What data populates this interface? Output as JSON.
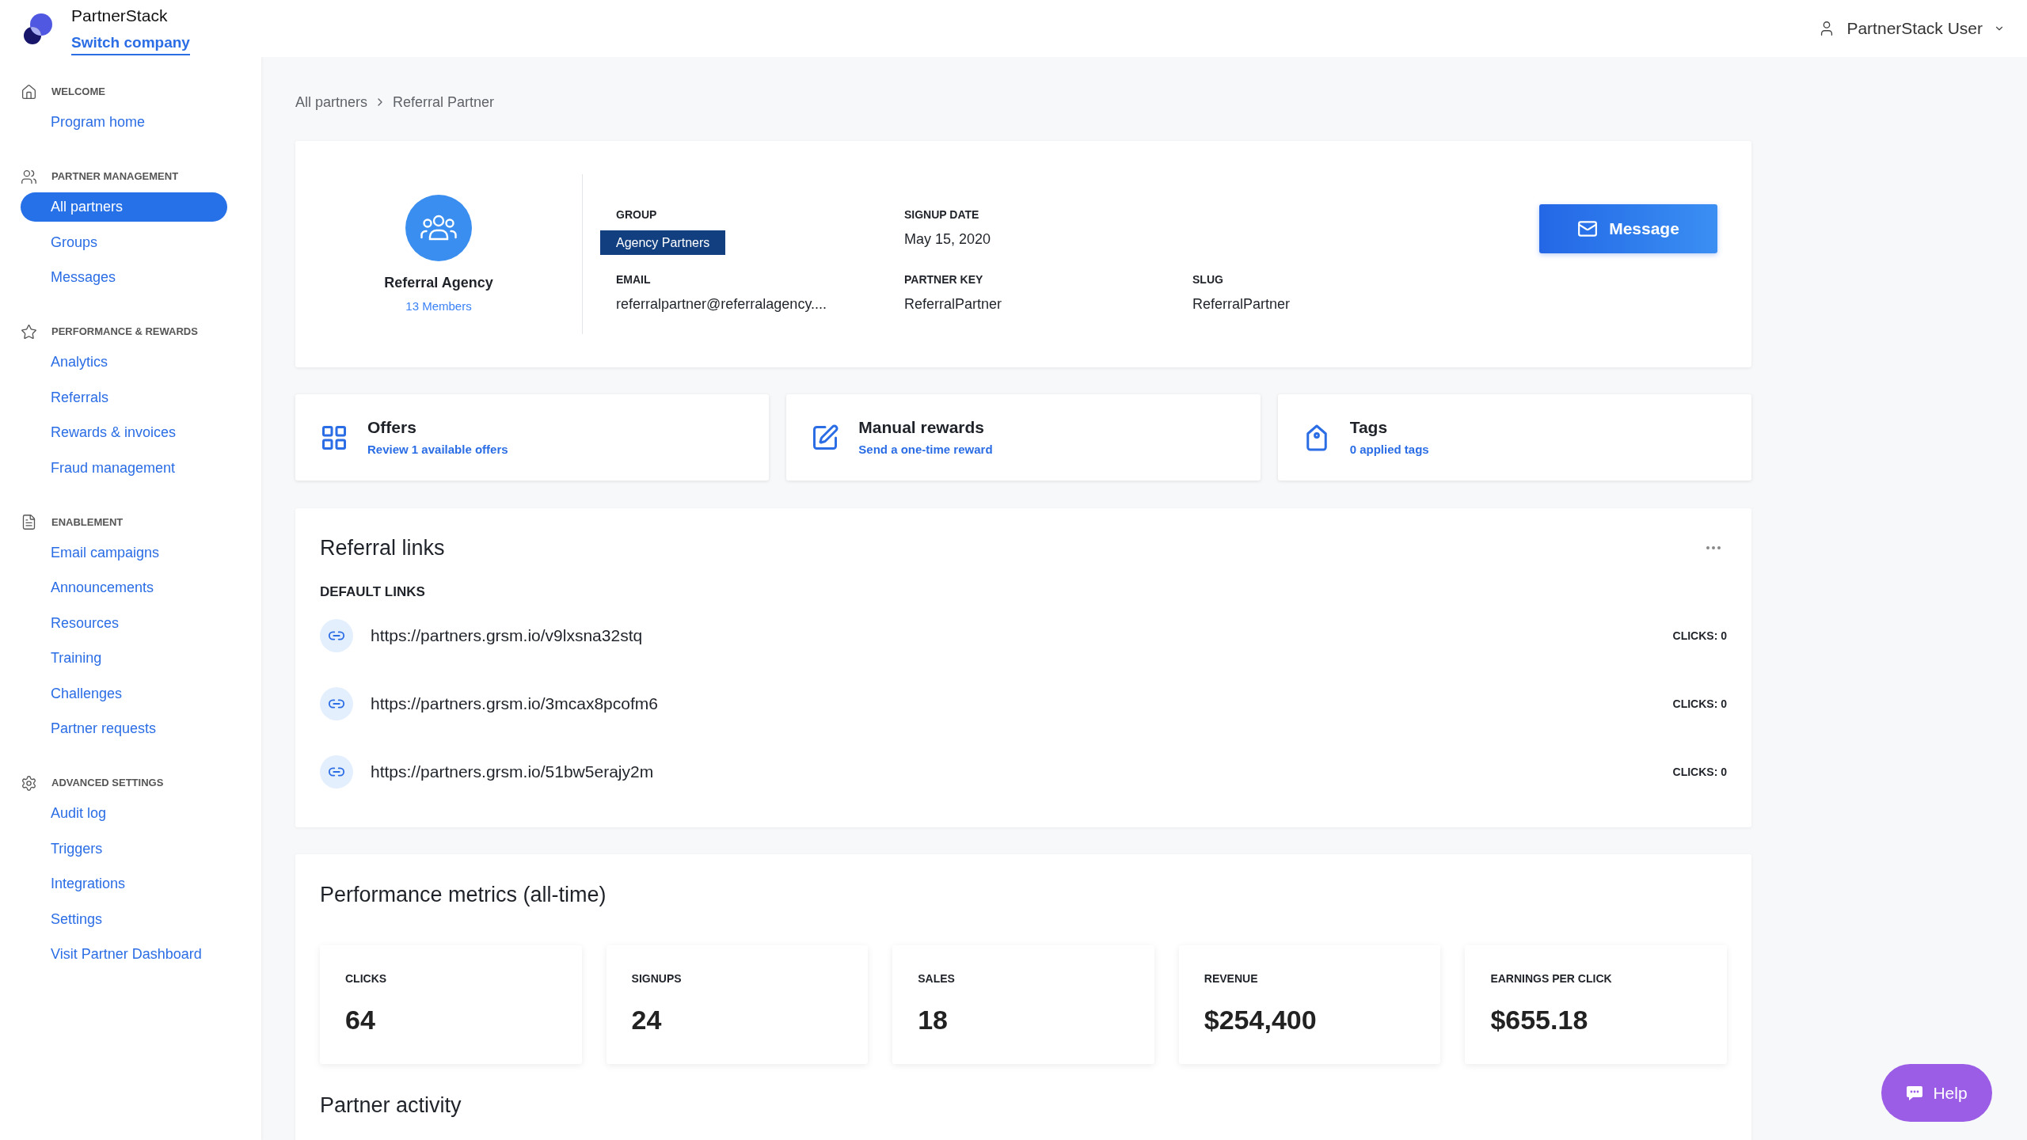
{
  "header": {
    "brand": "PartnerStack",
    "switch_company": "Switch company",
    "user": "PartnerStack User"
  },
  "sidebar": {
    "sections": [
      {
        "title": "WELCOME",
        "items": [
          {
            "label": "Program home",
            "selected": false
          }
        ]
      },
      {
        "title": "PARTNER MANAGEMENT",
        "items": [
          {
            "label": "All partners",
            "selected": true
          },
          {
            "label": "Groups",
            "selected": false
          },
          {
            "label": "Messages",
            "selected": false
          }
        ]
      },
      {
        "title": "PERFORMANCE & REWARDS",
        "items": [
          {
            "label": "Analytics",
            "selected": false
          },
          {
            "label": "Referrals",
            "selected": false
          },
          {
            "label": "Rewards & invoices",
            "selected": false
          },
          {
            "label": "Fraud management",
            "selected": false
          }
        ]
      },
      {
        "title": "ENABLEMENT",
        "items": [
          {
            "label": "Email campaigns",
            "selected": false
          },
          {
            "label": "Announcements",
            "selected": false
          },
          {
            "label": "Resources",
            "selected": false
          },
          {
            "label": "Training",
            "selected": false
          },
          {
            "label": "Challenges",
            "selected": false
          },
          {
            "label": "Partner requests",
            "selected": false
          }
        ]
      },
      {
        "title": "ADVANCED SETTINGS",
        "items": [
          {
            "label": "Audit log",
            "selected": false
          },
          {
            "label": "Triggers",
            "selected": false
          },
          {
            "label": "Integrations",
            "selected": false
          },
          {
            "label": "Settings",
            "selected": false
          },
          {
            "label": "Visit Partner Dashboard",
            "selected": false
          }
        ]
      }
    ]
  },
  "breadcrumb": [
    "All partners",
    "Referral Partner"
  ],
  "partner": {
    "name": "Referral Agency",
    "members": "13 Members",
    "fields": [
      [
        {
          "label": "GROUP",
          "value": "Agency Partners",
          "kind": "badge"
        },
        {
          "label": "SIGNUP DATE",
          "value": "May 15, 2020",
          "kind": "text"
        }
      ],
      [
        {
          "label": "EMAIL",
          "value": "referralpartner@referralagency....",
          "kind": "text"
        },
        {
          "label": "PARTNER KEY",
          "value": "ReferralPartner",
          "kind": "text"
        },
        {
          "label": "SLUG",
          "value": "ReferralPartner",
          "kind": "text"
        }
      ]
    ],
    "button": "Message"
  },
  "actions": [
    {
      "title": "Offers",
      "link": "Review 1 available offers"
    },
    {
      "title": "Manual rewards",
      "link": "Send a one-time reward"
    },
    {
      "title": "Tags",
      "link": "0 applied tags"
    }
  ],
  "referral_links": {
    "title": "Referral links",
    "group": "DEFAULT LINKS",
    "links": [
      {
        "url": "https://partners.grsm.io/v9lxsna32stq",
        "clicks": "CLICKS: 0"
      },
      {
        "url": "https://partners.grsm.io/3mcax8pcofm6",
        "clicks": "CLICKS: 0"
      },
      {
        "url": "https://partners.grsm.io/51bw5erajy2m",
        "clicks": "CLICKS: 0"
      }
    ]
  },
  "performance": {
    "title": "Performance metrics (all-time)",
    "metrics": [
      {
        "label": "CLICKS",
        "value": "64"
      },
      {
        "label": "SIGNUPS",
        "value": "24"
      },
      {
        "label": "SALES",
        "value": "18"
      },
      {
        "label": "REVENUE",
        "value": "$254,400"
      },
      {
        "label": "EARNINGS PER CLICK",
        "value": "$655.18"
      }
    ]
  },
  "partner_activity": {
    "title": "Partner activity"
  },
  "help": "Help"
}
